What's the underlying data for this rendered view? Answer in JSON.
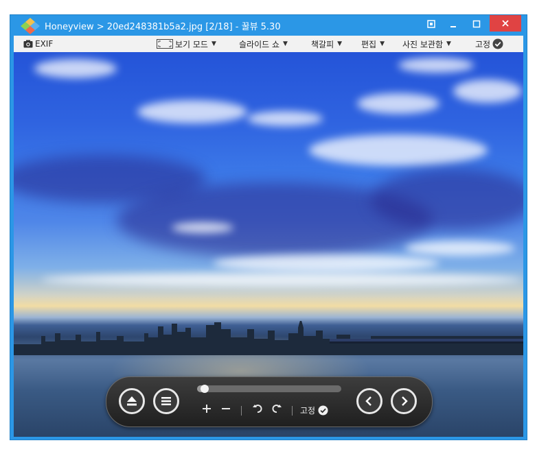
{
  "titlebar": {
    "title": "Honeyview > 20ed248381b5a2.jpg [2/18] - 꿀뷰 5.30"
  },
  "menu": {
    "exif": "EXIF",
    "view_mode": "보기 모드",
    "slideshow": "슬라이드 쇼",
    "bookmark": "책갈피",
    "edit": "편집",
    "photo_album": "사진 보관함",
    "pin": "고정"
  },
  "controls": {
    "pin": "고정",
    "progress": 0.05
  },
  "colors": {
    "titlebar": "#2b97e6",
    "close": "#e04343",
    "menubar": "#f2f2f2"
  }
}
